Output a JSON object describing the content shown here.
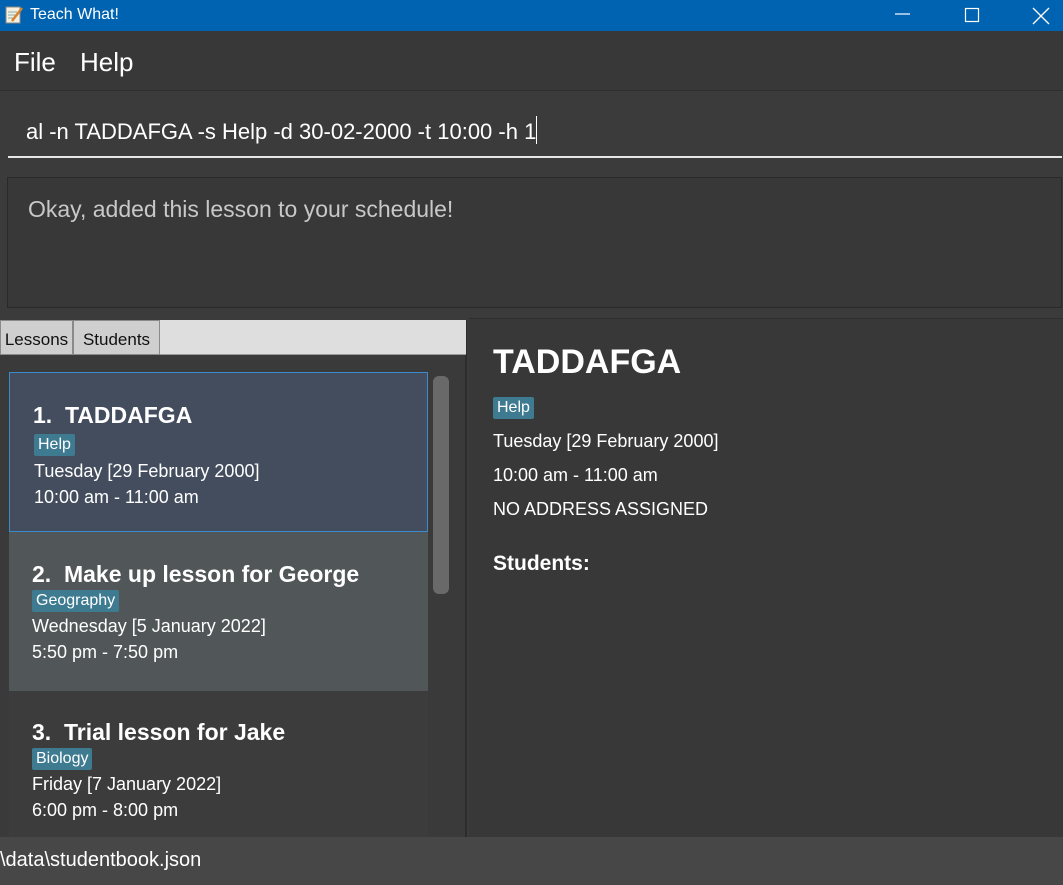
{
  "window": {
    "title": "Teach What!"
  },
  "menu": {
    "file": "File",
    "help": "Help"
  },
  "command": {
    "value": "al -n TADDAFGA -s Help -d 30-02-2000 -t 10:00 -h 1"
  },
  "result": {
    "message": "Okay, added this lesson to your schedule!"
  },
  "tabs": {
    "lessons": "Lessons",
    "students": "Students"
  },
  "lessons": [
    {
      "index": "1.",
      "name": "TADDAFGA",
      "subject": "Help",
      "date": "Tuesday [29 February 2000]",
      "time": "10:00 am - 11:00 am"
    },
    {
      "index": "2.",
      "name": "Make up lesson for George",
      "subject": "Geography",
      "date": "Wednesday [5 January 2022]",
      "time": "5:50 pm - 7:50 pm"
    },
    {
      "index": "3.",
      "name": "Trial lesson for Jake",
      "subject": "Biology",
      "date": "Friday [7 January 2022]",
      "time": "6:00 pm - 8:00 pm"
    }
  ],
  "detail": {
    "title": "TADDAFGA",
    "subject": "Help",
    "date": "Tuesday [29 February 2000]",
    "time": "10:00 am - 11:00 am",
    "address": "NO ADDRESS ASSIGNED",
    "students_label": "Students:"
  },
  "status": {
    "path": "\\data\\studentbook.json"
  },
  "colors": {
    "titlebar": "#0063b1",
    "tag": "#3e7b91",
    "selected_card": "#434d5e",
    "card_alt": "#515658"
  }
}
